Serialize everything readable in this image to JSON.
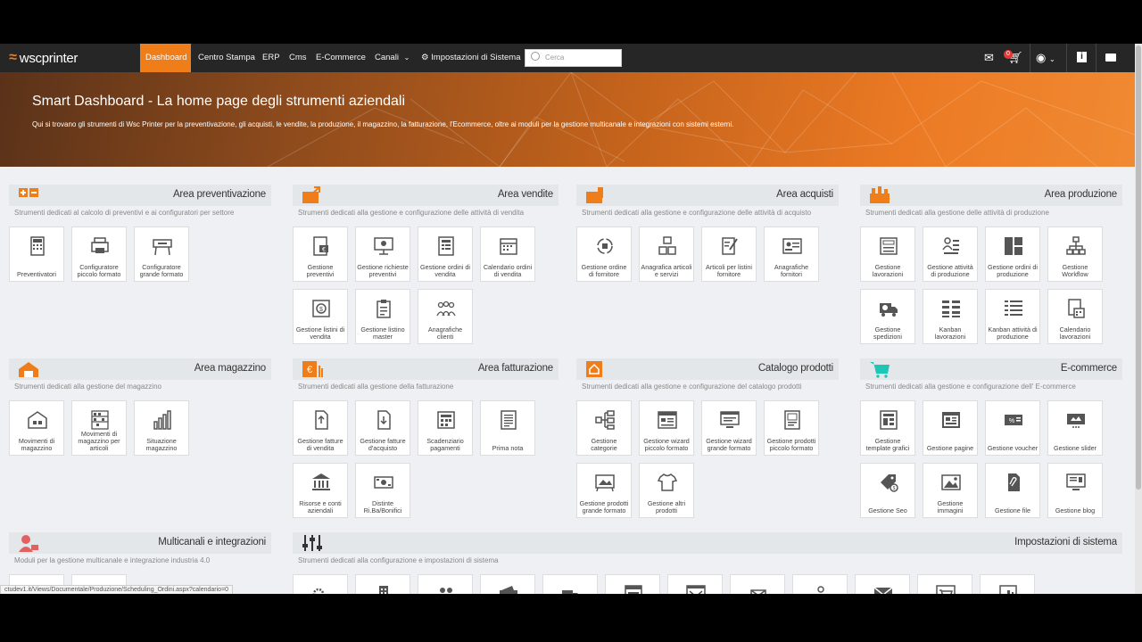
{
  "brand": {
    "name": "wscprinter",
    "accent": "#ef7d1a"
  },
  "nav": {
    "items": [
      {
        "label": "Dashboard",
        "active": true
      },
      {
        "label": "Centro Stampa"
      },
      {
        "label": "ERP"
      },
      {
        "label": "Cms"
      },
      {
        "label": "E-Commerce"
      },
      {
        "label": "Canali"
      },
      {
        "label": "Impostazioni di Sistema"
      }
    ],
    "search_placeholder": "Cerca",
    "cart_badge": "0",
    "icons": [
      "envelope-icon",
      "cart-icon",
      "user-icon",
      "info-icon",
      "chat-icon"
    ]
  },
  "hero": {
    "title": "Smart Dashboard - La home page degli strumenti aziendali",
    "subtitle": "Qui si trovano gli strumenti di Wsc Printer per la preventivazione, gli acquisti, le vendite, la produzione, il magazzino, la fatturazione, l'Ecommerce, oltre ai moduli per la gestione multicanale e integrazioni con sistemi esterni."
  },
  "areas": {
    "preventivazione": {
      "title": "Area preventivazione",
      "desc": "Strumenti dedicati al calcolo di preventivi e ai configuratori per settore",
      "tiles": [
        "Preventivatori",
        "Configuratore piccolo formato",
        "Configuratore grande formato"
      ]
    },
    "vendite": {
      "title": "Area vendite",
      "desc": "Strumenti dedicati alla gestione e configurazione delle attività di vendita",
      "tiles": [
        "Gestione preventivi",
        "Gestione richieste preventivi",
        "Gestione ordini di vendita",
        "Calendario ordini di vendita",
        "Gestione listini di vendita",
        "Gestione listino master",
        "Anagrafiche clienti"
      ]
    },
    "acquisti": {
      "title": "Area acquisti",
      "desc": "Strumenti dedicati alla gestione e configurazione delle attività di acquisto",
      "tiles": [
        "Gestione ordine di fornitore",
        "Anagrafica articoli e servizi",
        "Articoli per listini fornitore",
        "Anagrafiche fornitori"
      ]
    },
    "produzione": {
      "title": "Area produzione",
      "desc": "Strumenti dedicati alla gestione delle attività di produzione",
      "tiles": [
        "Gestione lavorazioni",
        "Gestione attività di produzione",
        "Gestione ordini di produzione",
        "Gestione Workflow",
        "Gestione spedizioni",
        "Kanban lavorazioni",
        "Kanban attività di produzione",
        "Calendario lavorazioni"
      ]
    },
    "magazzino": {
      "title": "Area magazzino",
      "desc": "Strumenti dedicati alla gestione del magazzino",
      "tiles": [
        "Movimenti di magazzino",
        "Movimenti di magazzino per articoli",
        "Situazione magazzino"
      ]
    },
    "fatturazione": {
      "title": "Area fatturazione",
      "desc": "Strumenti dedicati alla gestione della fatturazione",
      "tiles": [
        "Gestione fatture di vendita",
        "Gestione fatture d'acquisto",
        "Scadenziario pagamenti",
        "Prima nota",
        "Risorse e conti aziendali",
        "Distinte Ri.Ba/Bonifici"
      ]
    },
    "catalogo": {
      "title": "Catalogo prodotti",
      "desc": "Strumenti dedicati alla gestione e configurazione del catalogo prodotti",
      "tiles": [
        "Gestione categorie",
        "Gestione wizard piccolo formato",
        "Gestione wizard grande formato",
        "Gestione prodotti piccolo formato",
        "Gestione prodotti grande formato",
        "Gestione altri prodotti"
      ]
    },
    "ecommerce": {
      "title": "E-commerce",
      "desc": "Strumenti dedicati alla gestione e configurazione dell' E-commerce",
      "tiles": [
        "Gestione template grafici",
        "Gestione pagine",
        "Gestione voucher",
        "Gestione slider",
        "Gestione Seo",
        "Gestione immagini",
        "Gestione file",
        "Gestione blog"
      ]
    },
    "multicanali": {
      "title": "Multicanali e integrazioni",
      "desc": "Moduli per la gestione multicanale e integrazione industria 4.0"
    },
    "impostazioni": {
      "title": "Impostazioni di sistema",
      "desc": "Strumenti dedicati alla configurazione e impostazioni di sistema"
    }
  },
  "status_url": "ctudev1.it/Views/Documentale/Produzione/Scheduling_Ordini.aspx?calendario=0"
}
